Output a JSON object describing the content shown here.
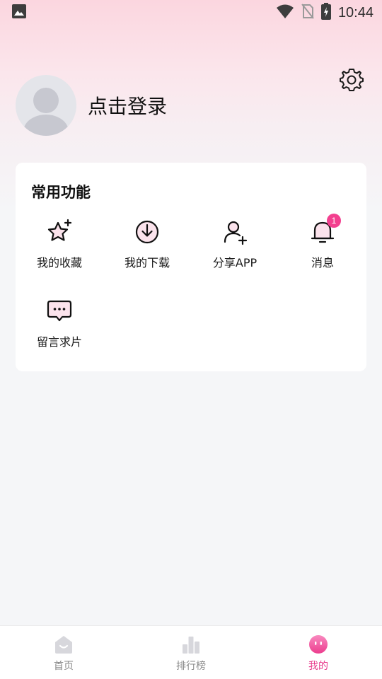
{
  "status_bar": {
    "time": "10:44"
  },
  "profile": {
    "login_label": "点击登录"
  },
  "functions": {
    "title": "常用功能",
    "items": [
      {
        "label": "我的收藏",
        "icon": "star-plus-icon"
      },
      {
        "label": "我的下载",
        "icon": "download-icon"
      },
      {
        "label": "分享APP",
        "icon": "add-user-icon"
      },
      {
        "label": "消息",
        "icon": "bell-icon",
        "badge": "1"
      },
      {
        "label": "留言求片",
        "icon": "chat-bubble-icon"
      }
    ]
  },
  "bottom_nav": {
    "tabs": [
      {
        "label": "首页",
        "icon": "home-icon",
        "active": false
      },
      {
        "label": "排行榜",
        "icon": "ranking-icon",
        "active": false
      },
      {
        "label": "我的",
        "icon": "profile-face-icon",
        "active": true
      }
    ]
  },
  "colors": {
    "accent": "#e8398b",
    "badge": "#f3408f",
    "background": "#f5f6f8"
  }
}
